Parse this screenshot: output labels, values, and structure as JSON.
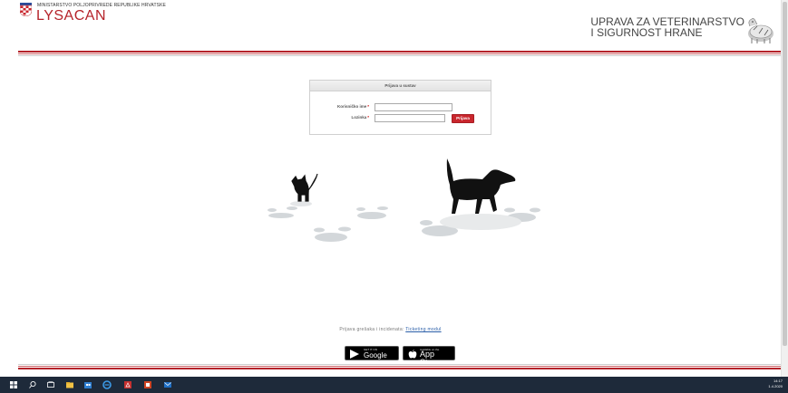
{
  "header": {
    "ministry": "MINISTARSTVO POLJOPRIVREDE REPUBLIKE HRVATSKE",
    "brand": "LYSACAN",
    "agency_line1": "UPRAVA ZA VETERINARSTVO",
    "agency_line2": "I SIGURNOST HRANE"
  },
  "login": {
    "title": "Prijava u sustav",
    "username_label": "Korisničko ime",
    "password_label": "Lozinka",
    "required_mark": "*",
    "submit_label": "Prijava"
  },
  "footer": {
    "report_text": "Prijava grešaka i incidenata:",
    "report_link": "Ticketing modul",
    "google_small": "GET IT ON",
    "google_big": "Google play",
    "apple_small": "Available on the",
    "apple_big": "App Store"
  },
  "taskbar": {
    "time": "14:17",
    "date": "1.4.2020"
  },
  "colors": {
    "brand_red": "#b5232a",
    "taskbar": "#1e2a3a"
  }
}
